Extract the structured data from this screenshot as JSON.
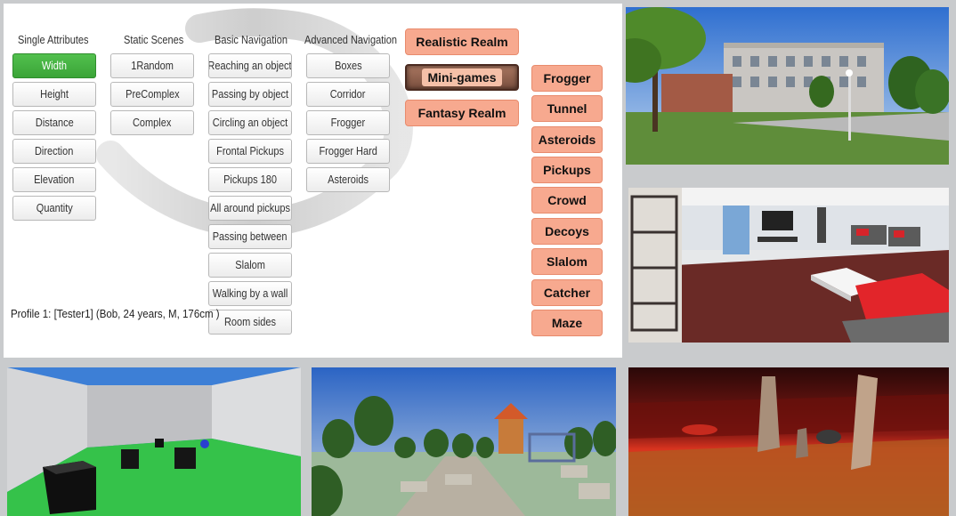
{
  "columns": {
    "single_attributes": {
      "header": "Single Attributes",
      "items": [
        "Width",
        "Height",
        "Distance",
        "Direction",
        "Elevation",
        "Quantity"
      ]
    },
    "static_scenes": {
      "header": "Static Scenes",
      "items": [
        "1Random",
        "PreComplex",
        "Complex"
      ]
    },
    "basic_navigation": {
      "header": "Basic Navigation",
      "items": [
        "Reaching an object",
        "Passing by object",
        "Circling an object",
        "Frontal Pickups",
        "Pickups 180",
        "All around pickups",
        "Passing between",
        "Slalom",
        "Walking by a wall",
        "Room sides"
      ]
    },
    "advanced_navigation": {
      "header": "Advanced Navigation",
      "items": [
        "Boxes",
        "Corridor",
        "Frogger",
        "Frogger Hard",
        "Asteroids"
      ]
    }
  },
  "realms": [
    "Realistic Realm",
    "Mini-games",
    "Fantasy Realm"
  ],
  "minigames": [
    "Frogger",
    "Tunnel",
    "Asteroids",
    "Pickups",
    "Crowd",
    "Decoys",
    "Slalom",
    "Catcher",
    "Maze"
  ],
  "profile": "Profile 1: [Tester1] (Bob, 24 years, M, 176cm )",
  "colors": {
    "selected": "#3fa93b",
    "orange_button": "#f7a98f",
    "background": "#c9cbcd"
  }
}
